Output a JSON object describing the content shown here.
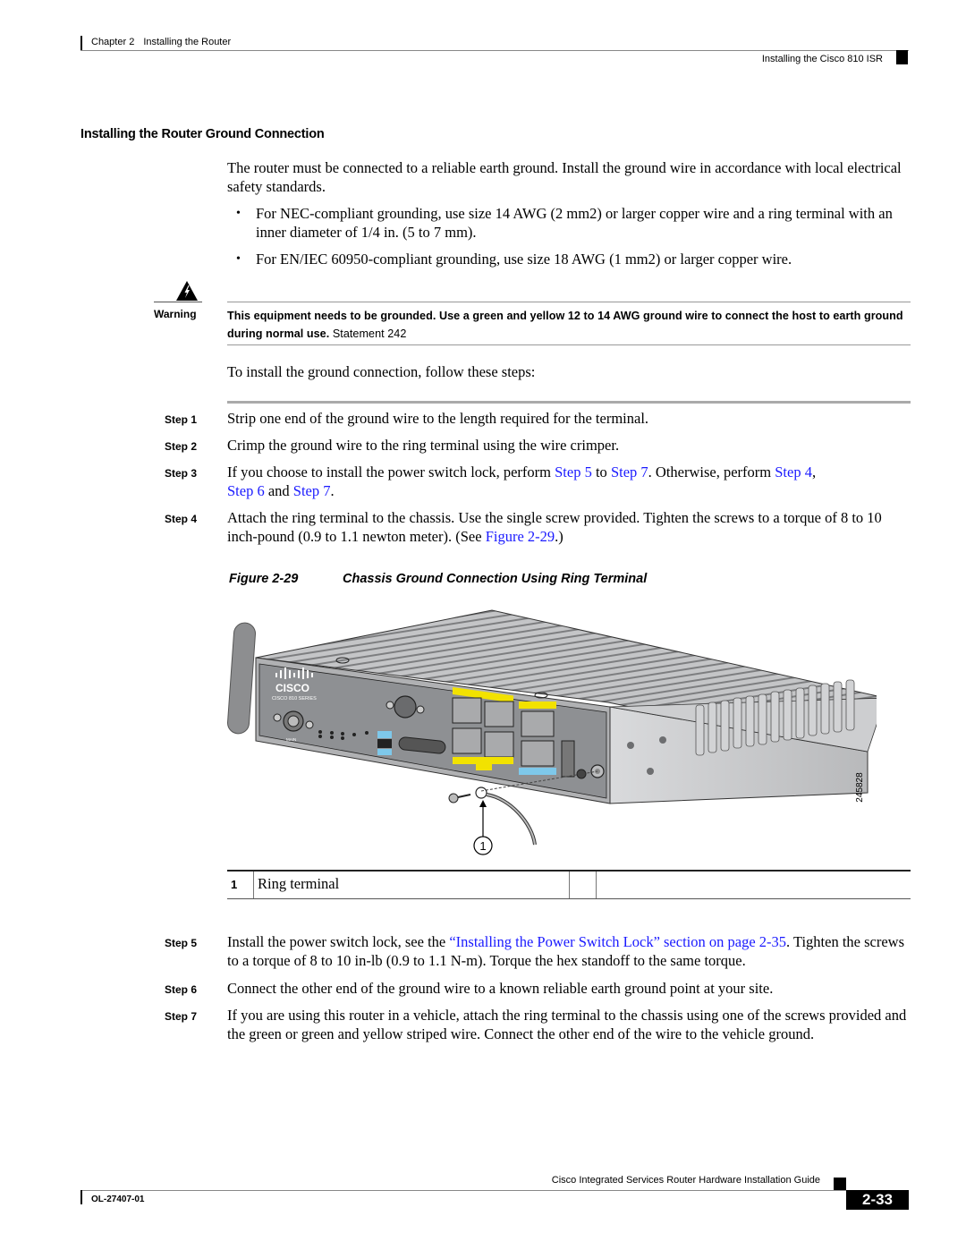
{
  "header": {
    "chapter": "Chapter 2",
    "chapter_title": "Installing the Router",
    "section": "Installing the Cisco 810 ISR"
  },
  "section_title": "Installing the Router Ground Connection",
  "intro": "The router must be connected to a reliable earth ground. Install the ground wire in accordance with local electrical safety standards.",
  "bullets": [
    "For NEC-compliant grounding, use size 14 AWG (2 mm2) or larger copper wire and a ring terminal with an inner diameter of 1/4 in. (5 to 7 mm).",
    "For EN/IEC 60950-compliant grounding, use size 18 AWG (1 mm2) or larger copper wire."
  ],
  "bullet_glyph": "•",
  "warning": {
    "icon": "warning-triangle-icon",
    "label": "Warning",
    "text": "This equipment needs to be grounded. Use a green and yellow  12 to 14 AWG ground wire to connect the host to earth ground during normal use.",
    "statement": " Statement 242"
  },
  "steps_intro": "To install the ground connection, follow these steps:",
  "steps": [
    {
      "label": "Step 1",
      "text": "Strip one end of the ground wire to the length required for the terminal."
    },
    {
      "label": "Step 2",
      "text": "Crimp the ground wire to the ring terminal using the wire crimper."
    },
    {
      "label": "Step 3",
      "parts": {
        "t1": "If you choose to install the power switch lock, perform ",
        "l1": "Step 5",
        "t2": " to ",
        "l2": "Step 7",
        "t3": ". Otherwise, perform ",
        "l3": "Step 4",
        "t4": ", ",
        "l4": "Step 6",
        "t5": " and ",
        "l5": "Step 7",
        "t6": "."
      }
    },
    {
      "label": "Step 4",
      "parts": {
        "t1": "Attach the ring terminal to the chassis. Use the single screw provided. Tighten the screws to a torque of 8 to 10 inch-pound (0.9 to 1.1 newton meter). (See ",
        "l1": "Figure 2-29",
        "t2": ".)"
      }
    },
    {
      "label": "Step 5",
      "parts": {
        "t1": "Install the power switch lock, see the ",
        "l1": "“Installing the Power Switch Lock” section on page 2-35",
        "t2": ". Tighten the screws to a torque of 8 to 10 in-lb (0.9 to 1.1 N-m). Torque the hex standoff to the same torque."
      }
    },
    {
      "label": "Step 6",
      "text": "Connect the other end of the ground wire to a known reliable earth ground point at your site."
    },
    {
      "label": "Step 7",
      "text": "If you are using this router in a vehicle, attach the ring terminal to the chassis using one of the screws provided and the green or green and yellow striped wire. Connect the other end of the wire to the vehicle ground."
    }
  ],
  "figure": {
    "number": "Figure 2-29",
    "title": "Chassis Ground Connection Using Ring Terminal",
    "art_id": "245828",
    "callout": "1",
    "panel_labels": {
      "brand": "CISCO",
      "series": "CISCO 810 SERIES",
      "main": "MAIN",
      "leds_top": [
        "SYS",
        "WWAN",
        "RSSI",
        "GPS"
      ],
      "leds_bottom": [
        "ACT",
        "SIM",
        "3G"
      ],
      "reset": "RESET",
      "usb_top": "3G",
      "usb_bottom": "RSVD",
      "gps_port": "DIV/GPS",
      "serial": "SERIAL",
      "lan_top": [
        "FE 3",
        "FE 2"
      ],
      "lan_bottom": [
        "FE 1",
        "FE 0"
      ],
      "lan_label": "LAN",
      "wan": "GE WAN 0",
      "con_aux": "CON / AUX",
      "power": "5VDC 2.0A"
    },
    "colors": {
      "lan_label": "#f2e200",
      "console_label": "#7ec8ea",
      "chassis": "#c8c9cb",
      "panel": "#8e9093"
    }
  },
  "legend": [
    {
      "num": "1",
      "text": "Ring terminal"
    }
  ],
  "footer": {
    "guide": "Cisco Integrated Services Router Hardware Installation Guide",
    "doc_id": "OL-27407-01",
    "page": "2-33"
  }
}
